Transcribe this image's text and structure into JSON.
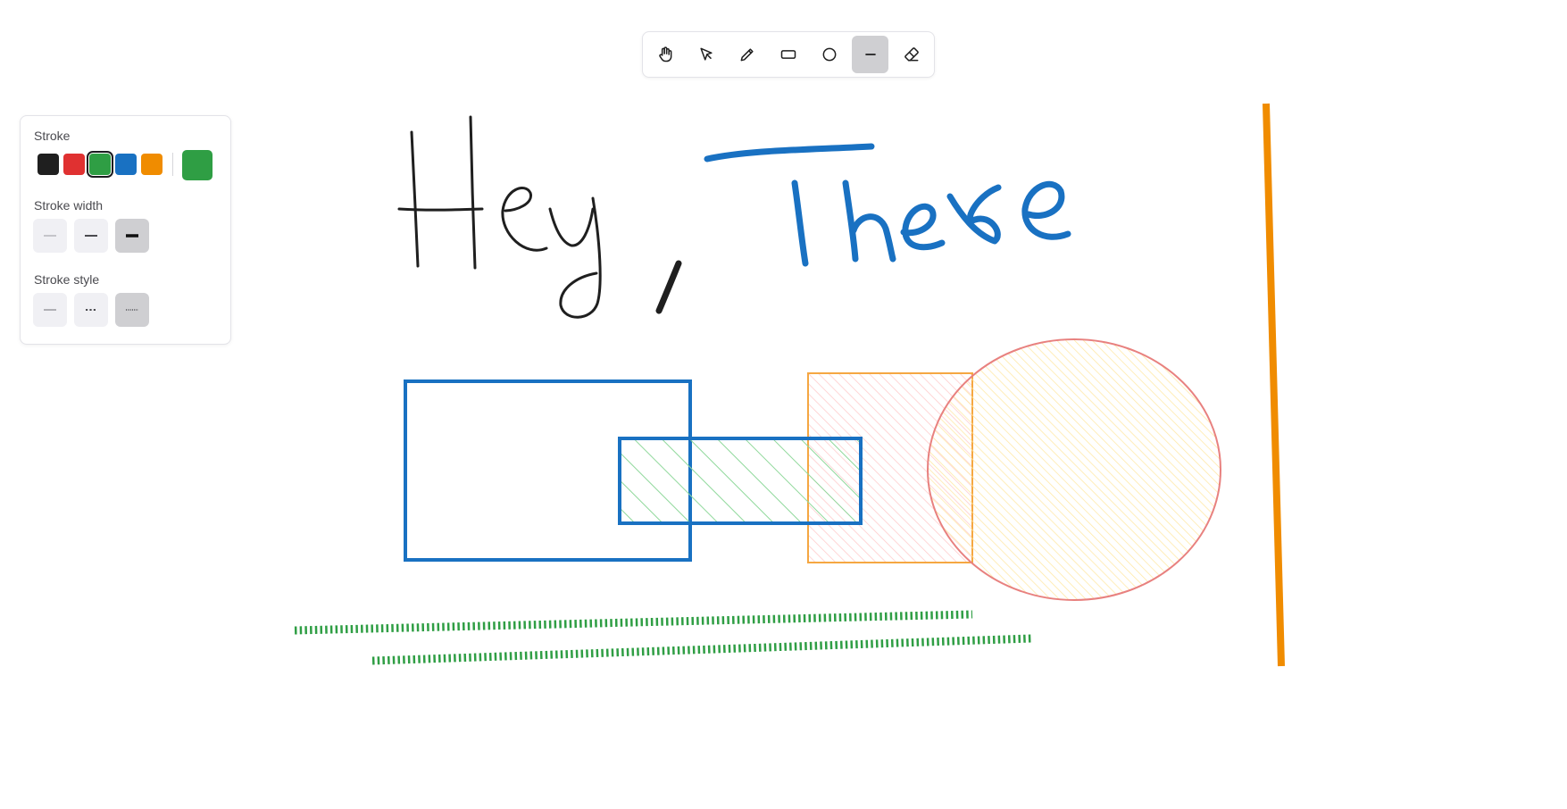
{
  "toolbar": {
    "tools": [
      {
        "name": "hand",
        "icon": "hand-icon"
      },
      {
        "name": "select",
        "icon": "cursor-arrow-icon"
      },
      {
        "name": "draw",
        "icon": "pencil-icon"
      },
      {
        "name": "rectangle",
        "icon": "rectangle-icon"
      },
      {
        "name": "ellipse",
        "icon": "circle-icon"
      },
      {
        "name": "line",
        "icon": "line-icon",
        "active": true
      },
      {
        "name": "eraser",
        "icon": "eraser-icon"
      }
    ]
  },
  "panel": {
    "stroke_label": "Stroke",
    "stroke_width_label": "Stroke width",
    "stroke_style_label": "Stroke style",
    "colors": [
      "#1f1f1f",
      "#e03131",
      "#2f9e44",
      "#1971c2",
      "#f08c00"
    ],
    "selected_color": "#2f9e44",
    "stroke_widths": [
      "thin",
      "medium",
      "bold"
    ],
    "selected_stroke_width": "bold",
    "stroke_styles": [
      "solid",
      "dashed",
      "dotted"
    ],
    "selected_stroke_style": "dotted"
  },
  "canvas": {
    "handwriting": [
      {
        "text": "Hey ,",
        "color": "#1f1f1f"
      },
      {
        "text": "There",
        "color": "#1971c2"
      }
    ],
    "shape_colors": {
      "blue": "#1971c2",
      "green_fill": "#b2f2bb",
      "orange": "#f08c00",
      "red": "#e03131",
      "pink_fill": "#ffc9c9",
      "yellow_fill": "#ffec99",
      "green": "#2f9e44"
    }
  }
}
